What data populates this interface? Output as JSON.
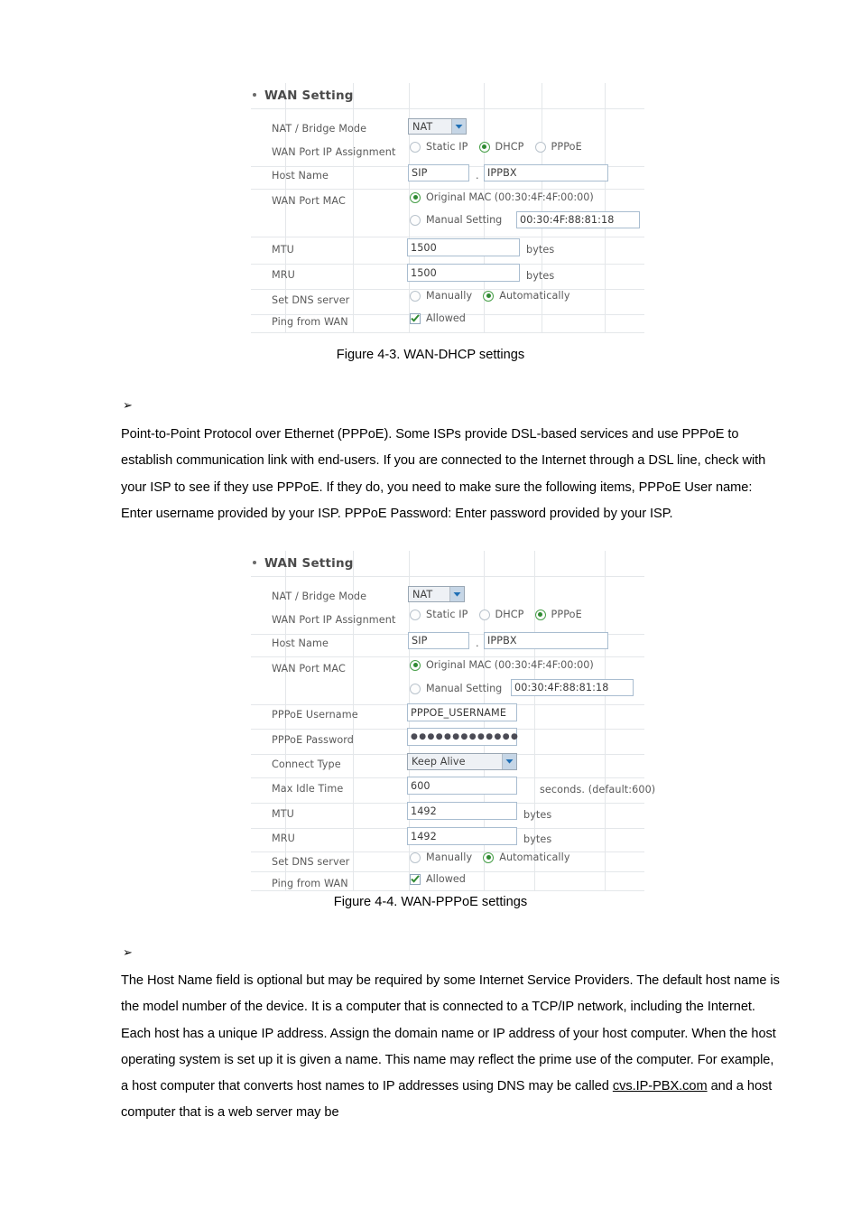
{
  "figure1": {
    "panel_title": "WAN Setting",
    "rows": {
      "nat_bridge_label": "NAT / Bridge Mode",
      "nat_bridge_value": "NAT",
      "ip_assign_label": "WAN Port IP Assignment",
      "ip_assign_options": [
        "Static IP",
        "DHCP",
        "PPPoE"
      ],
      "ip_assign_selected": "DHCP",
      "host_name_label": "Host Name",
      "host_name_part1": "SIP",
      "host_name_sep": ".",
      "host_name_part2": "IPPBX",
      "wan_port_mac_label": "WAN Port MAC",
      "original_mac_label": "Original MAC (00:30:4F:4F:00:00)",
      "manual_setting_label": "Manual Setting",
      "manual_mac_value": "00:30:4F:88:81:18",
      "mac_selected": "Original MAC",
      "mtu_label": "MTU",
      "mtu_value": "1500",
      "mtu_unit": "bytes",
      "mru_label": "MRU",
      "mru_value": "1500",
      "mru_unit": "bytes",
      "dns_label": "Set DNS server",
      "dns_options": [
        "Manually",
        "Automatically"
      ],
      "dns_selected": "Automatically",
      "ping_label": "Ping from WAN",
      "ping_checkbox_label": "Allowed",
      "ping_checked": true
    },
    "caption": "Figure 4-3. WAN-DHCP settings"
  },
  "paragraph1": {
    "bullet": "➢",
    "text": "Point-to-Point Protocol over Ethernet (PPPoE). Some ISPs provide DSL-based services and use PPPoE to establish communication link with end-users. If you are connected to the Internet through a DSL line, check with your ISP to see if they use PPPoE. If they do, you need to make sure the following items, PPPoE User name: Enter username provided by your ISP. PPPoE Password: Enter password provided by your ISP."
  },
  "figure2": {
    "panel_title": "WAN Setting",
    "rows": {
      "nat_bridge_label": "NAT / Bridge Mode",
      "nat_bridge_value": "NAT",
      "ip_assign_label": "WAN Port IP Assignment",
      "ip_assign_options": [
        "Static IP",
        "DHCP",
        "PPPoE"
      ],
      "ip_assign_selected": "PPPoE",
      "host_name_label": "Host Name",
      "host_name_part1": "SIP",
      "host_name_sep": ".",
      "host_name_part2": "IPPBX",
      "wan_port_mac_label": "WAN Port MAC",
      "original_mac_label": "Original MAC (00:30:4F:4F:00:00)",
      "manual_setting_label": "Manual Setting",
      "manual_mac_value": "00:30:4F:88:81:18",
      "mac_selected": "Original MAC",
      "pppoe_username_label": "PPPoE Username",
      "pppoe_username_value": "PPPOE_USERNAME",
      "pppoe_password_label": "PPPoE Password",
      "pppoe_password_value": "●●●●●●●●●●●●●",
      "connect_type_label": "Connect Type",
      "connect_type_value": "Keep Alive",
      "max_idle_label": "Max Idle Time",
      "max_idle_value": "600",
      "max_idle_unit": "seconds. (default:600)",
      "mtu_label": "MTU",
      "mtu_value": "1492",
      "mtu_unit": "bytes",
      "mru_label": "MRU",
      "mru_value": "1492",
      "mru_unit": "bytes",
      "dns_label": "Set DNS server",
      "dns_options": [
        "Manually",
        "Automatically"
      ],
      "dns_selected": "Automatically",
      "ping_label": "Ping from WAN",
      "ping_checkbox_label": "Allowed",
      "ping_checked": true
    },
    "caption": "Figure 4-4. WAN-PPPoE settings"
  },
  "paragraph2": {
    "bullet": "➢",
    "text_before_link": "The Host Name field is optional but may be required by some Internet Service Providers. The default host name is the model number of the device. It is a computer that is connected to a TCP/IP network, including the Internet. Each host has a unique IP address. Assign the domain name or IP address of your host computer. When the host operating system is set up it is given a name. This name may reflect the prime use of the computer. For example, a host computer that converts host names to IP addresses using DNS may be called ",
    "link_text": "cvs.IP-PBX.com",
    "text_after_link": " and a host computer that is a web server may be"
  },
  "colors": {
    "accent_green": "#2f8a32",
    "input_border": "#a9bdd0",
    "select_arrow": "#1f6fb5",
    "gridline": "#e4e7ea",
    "label_text": "#5a5a5a"
  }
}
